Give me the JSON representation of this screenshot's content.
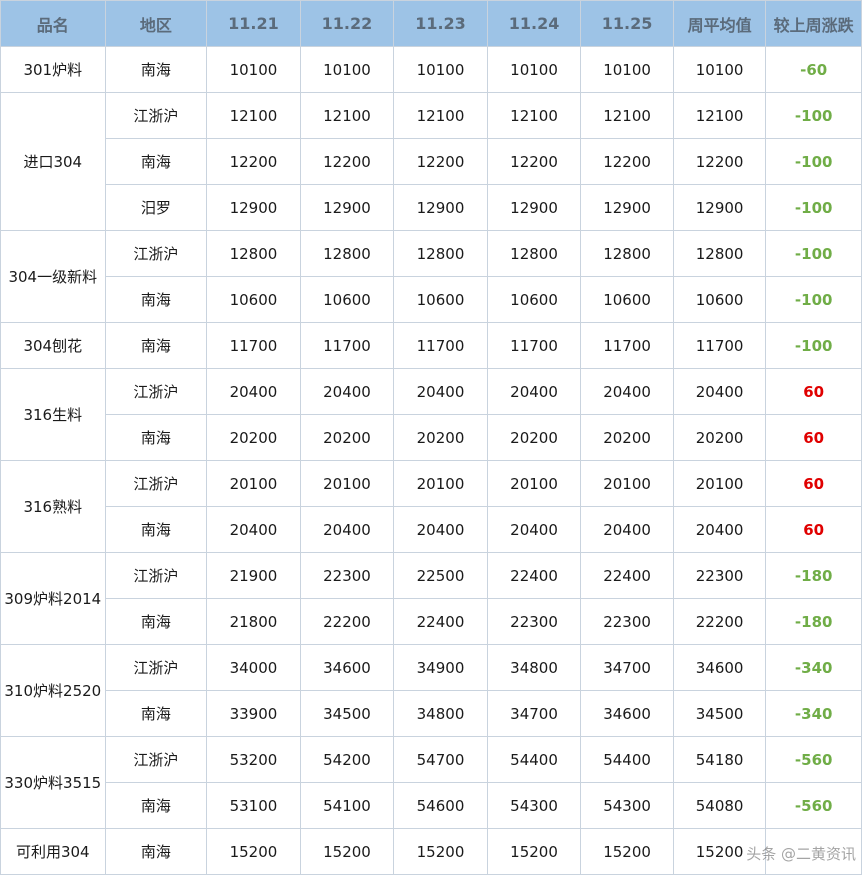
{
  "headers": [
    "品名",
    "地区",
    "11.21",
    "11.22",
    "11.23",
    "11.24",
    "11.25",
    "周平均值",
    "较上周涨跌"
  ],
  "groups": [
    {
      "name": "301炉料",
      "rows": [
        {
          "region": "南海",
          "prices": [
            "10100",
            "10100",
            "10100",
            "10100",
            "10100"
          ],
          "avg": "10100",
          "change": "-60",
          "dir": "down"
        }
      ]
    },
    {
      "name": "进口304",
      "rows": [
        {
          "region": "江浙沪",
          "prices": [
            "12100",
            "12100",
            "12100",
            "12100",
            "12100"
          ],
          "avg": "12100",
          "change": "-100",
          "dir": "down"
        },
        {
          "region": "南海",
          "prices": [
            "12200",
            "12200",
            "12200",
            "12200",
            "12200"
          ],
          "avg": "12200",
          "change": "-100",
          "dir": "down"
        },
        {
          "region": "汨罗",
          "prices": [
            "12900",
            "12900",
            "12900",
            "12900",
            "12900"
          ],
          "avg": "12900",
          "change": "-100",
          "dir": "down"
        }
      ]
    },
    {
      "name": "304一级新料",
      "rows": [
        {
          "region": "江浙沪",
          "prices": [
            "12800",
            "12800",
            "12800",
            "12800",
            "12800"
          ],
          "avg": "12800",
          "change": "-100",
          "dir": "down"
        },
        {
          "region": "南海",
          "prices": [
            "10600",
            "10600",
            "10600",
            "10600",
            "10600"
          ],
          "avg": "10600",
          "change": "-100",
          "dir": "down"
        }
      ]
    },
    {
      "name": "304刨花",
      "rows": [
        {
          "region": "南海",
          "prices": [
            "11700",
            "11700",
            "11700",
            "11700",
            "11700"
          ],
          "avg": "11700",
          "change": "-100",
          "dir": "down"
        }
      ]
    },
    {
      "name": "316生料",
      "rows": [
        {
          "region": "江浙沪",
          "prices": [
            "20400",
            "20400",
            "20400",
            "20400",
            "20400"
          ],
          "avg": "20400",
          "change": "60",
          "dir": "up"
        },
        {
          "region": "南海",
          "prices": [
            "20200",
            "20200",
            "20200",
            "20200",
            "20200"
          ],
          "avg": "20200",
          "change": "60",
          "dir": "up"
        }
      ]
    },
    {
      "name": "316熟料",
      "rows": [
        {
          "region": "江浙沪",
          "prices": [
            "20100",
            "20100",
            "20100",
            "20100",
            "20100"
          ],
          "avg": "20100",
          "change": "60",
          "dir": "up"
        },
        {
          "region": "南海",
          "prices": [
            "20400",
            "20400",
            "20400",
            "20400",
            "20400"
          ],
          "avg": "20400",
          "change": "60",
          "dir": "up"
        }
      ]
    },
    {
      "name": "309炉料2014",
      "rows": [
        {
          "region": "江浙沪",
          "prices": [
            "21900",
            "22300",
            "22500",
            "22400",
            "22400"
          ],
          "avg": "22300",
          "change": "-180",
          "dir": "down"
        },
        {
          "region": "南海",
          "prices": [
            "21800",
            "22200",
            "22400",
            "22300",
            "22300"
          ],
          "avg": "22200",
          "change": "-180",
          "dir": "down"
        }
      ]
    },
    {
      "name": "310炉料2520",
      "rows": [
        {
          "region": "江浙沪",
          "prices": [
            "34000",
            "34600",
            "34900",
            "34800",
            "34700"
          ],
          "avg": "34600",
          "change": "-340",
          "dir": "down"
        },
        {
          "region": "南海",
          "prices": [
            "33900",
            "34500",
            "34800",
            "34700",
            "34600"
          ],
          "avg": "34500",
          "change": "-340",
          "dir": "down"
        }
      ]
    },
    {
      "name": "330炉料3515",
      "rows": [
        {
          "region": "江浙沪",
          "prices": [
            "53200",
            "54200",
            "54700",
            "54400",
            "54400"
          ],
          "avg": "54180",
          "change": "-560",
          "dir": "down"
        },
        {
          "region": "南海",
          "prices": [
            "53100",
            "54100",
            "54600",
            "54300",
            "54300"
          ],
          "avg": "54080",
          "change": "-560",
          "dir": "down"
        }
      ]
    },
    {
      "name": "可利用304",
      "rows": [
        {
          "region": "南海",
          "prices": [
            "15200",
            "15200",
            "15200",
            "15200",
            "15200"
          ],
          "avg": "15200",
          "change": "",
          "dir": "down"
        }
      ]
    }
  ],
  "watermark": "头条 @二黄资讯",
  "colors": {
    "header_bg": "#9dc3e6",
    "header_text": "#5b6b7b",
    "down": "#70ad47",
    "up": "#e00000",
    "border": "#c9d3de"
  }
}
